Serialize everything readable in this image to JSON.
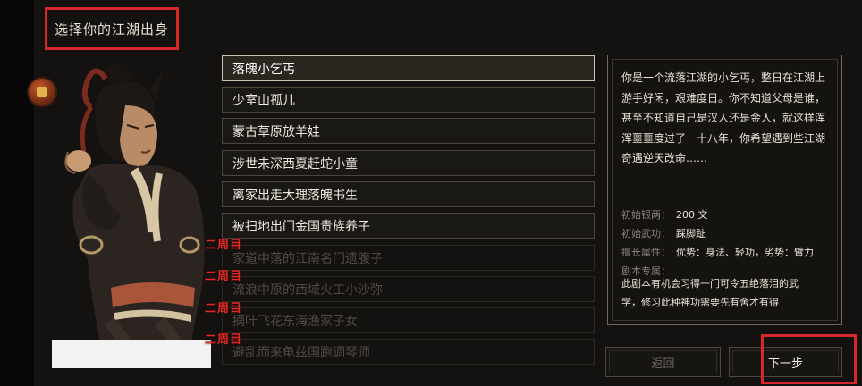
{
  "title": "选择你的江湖出身",
  "origins": [
    {
      "label": "落魄小乞丐",
      "state": "selected"
    },
    {
      "label": "少室山孤儿",
      "state": "normal"
    },
    {
      "label": "蒙古草原放羊娃",
      "state": "normal"
    },
    {
      "label": "涉世未深西夏赶蛇小童",
      "state": "normal"
    },
    {
      "label": "离家出走大理落魄书生",
      "state": "normal"
    },
    {
      "label": "被扫地出门金国贵族养子",
      "state": "normal"
    },
    {
      "label": "家道中落的江南名门遗腹子",
      "state": "locked"
    },
    {
      "label": "流浪中原的西域火工小沙弥",
      "state": "locked"
    },
    {
      "label": "摘叶飞花东海渔家子女",
      "state": "locked"
    },
    {
      "label": "避乱而来龟兹国跑调琴师",
      "state": "locked"
    }
  ],
  "round_tags": [
    "二周目",
    "二周目",
    "二周目",
    "二周目"
  ],
  "description": {
    "lines": [
      "你是一个流落江湖的小乞丐，整日在江湖上",
      "游手好闲，艰难度日。你不知道父母是谁，",
      "甚至不知道自己是汉人还是金人，就这样浑",
      "浑噩噩度过了一十八年，你希望遇到些江湖",
      "奇遇逆天改命……"
    ],
    "start_money_label": "初始银两：",
    "start_money_value": "200 文",
    "start_skill_label": "初始武功：",
    "start_skill_value": "踩脚趾",
    "traits_label": "擅长属性：",
    "traits_value": "优势：身法、轻功，劣势：臂力",
    "script_label": "剧本专属：",
    "script_lines": [
      "此剧本有机会习得一门可令五绝落泪的武",
      "学，修习此种神功需要先有舍才有得"
    ]
  },
  "buttons": {
    "back": "返回",
    "next": "下一步"
  },
  "colors": {
    "highlight": "#d9262a",
    "round_tag": "#e02b25"
  }
}
